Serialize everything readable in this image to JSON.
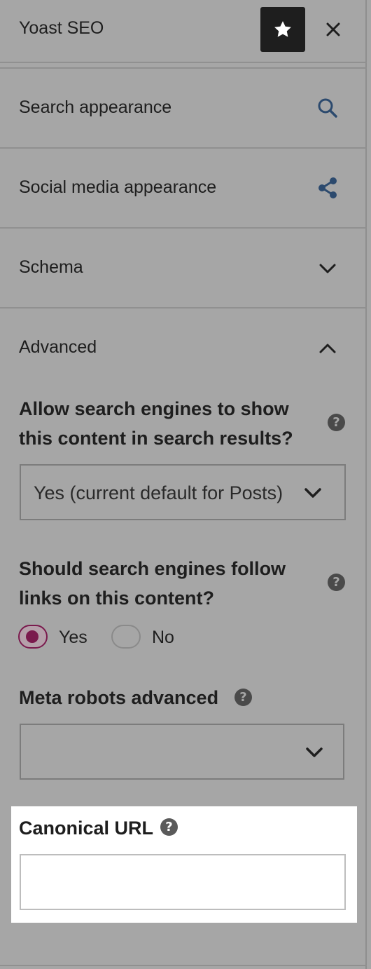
{
  "header": {
    "title": "Yoast SEO",
    "star_icon": "star-icon",
    "close_icon": "close-icon"
  },
  "sections": [
    {
      "label": "Search appearance",
      "icon": "search-icon"
    },
    {
      "label": "Social media appearance",
      "icon": "share-icon"
    },
    {
      "label": "Schema",
      "icon": "chevron-down-icon"
    },
    {
      "label": "Advanced",
      "icon": "chevron-up-icon"
    }
  ],
  "advanced": {
    "search_results": {
      "question_line1": "Allow search engines to show",
      "question_line2": "this content in search results?",
      "selected_value": "Yes (current default for Posts)"
    },
    "follow_links": {
      "question_line1": "Should search engines follow",
      "question_line2": "links on this content?",
      "options": [
        {
          "label": "Yes",
          "selected": true
        },
        {
          "label": "No",
          "selected": false
        }
      ]
    },
    "meta_robots": {
      "label": "Meta robots advanced",
      "selected_value": ""
    },
    "canonical": {
      "label": "Canonical URL",
      "value": ""
    }
  },
  "colors": {
    "overlay_bg": "#a6a6a6",
    "dark": "#1e1e1e",
    "radio_selected": "#7a1a4d",
    "highlight": "#ffffff"
  }
}
